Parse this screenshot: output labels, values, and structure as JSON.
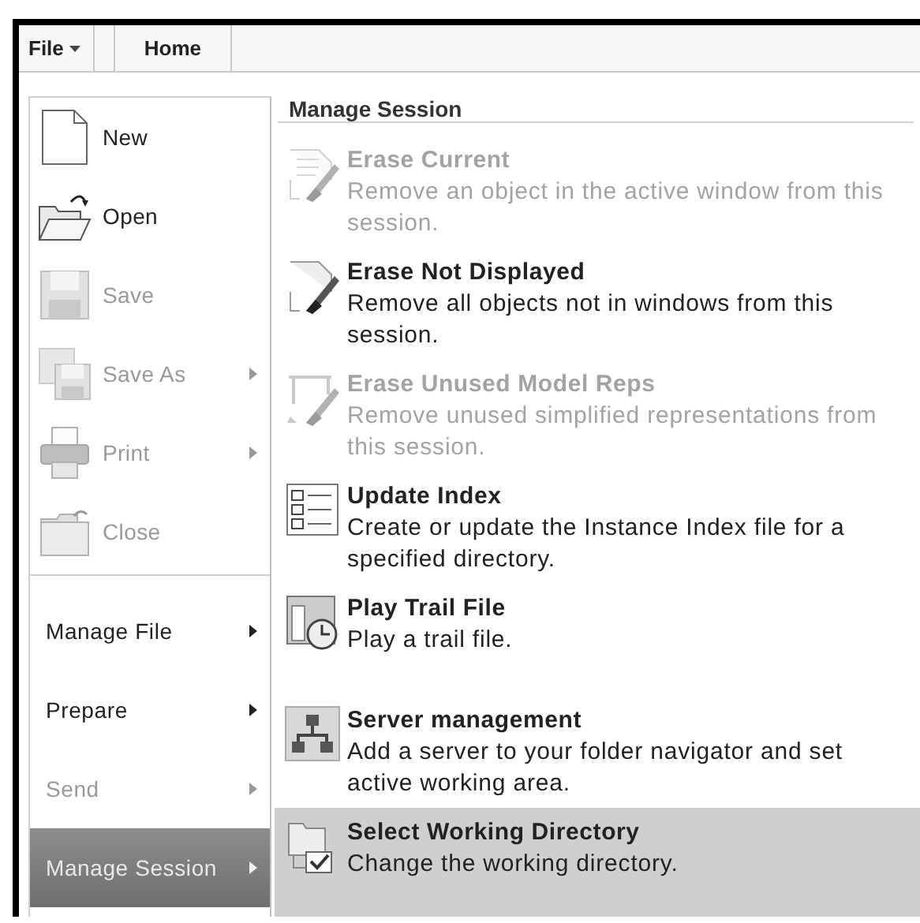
{
  "tabs": [
    {
      "label": "File",
      "kind": "dropdown"
    },
    {
      "label": "Home",
      "kind": "tab"
    }
  ],
  "commands": [
    {
      "label": "New",
      "disabled": false,
      "submenu": false
    },
    {
      "label": "Open",
      "disabled": false,
      "submenu": false
    },
    {
      "label": "Save",
      "disabled": true,
      "submenu": false
    },
    {
      "label": "Save As",
      "disabled": true,
      "submenu": true
    },
    {
      "label": "Print",
      "disabled": true,
      "submenu": true
    },
    {
      "label": "Close",
      "disabled": true,
      "submenu": false
    }
  ],
  "sections": [
    {
      "label": "Manage File",
      "disabled": false,
      "submenu": true,
      "selected": false
    },
    {
      "label": "Prepare",
      "disabled": false,
      "submenu": true,
      "selected": false
    },
    {
      "label": "Send",
      "disabled": true,
      "submenu": true,
      "selected": false
    },
    {
      "label": "Manage Session",
      "disabled": false,
      "submenu": true,
      "selected": true
    }
  ],
  "panel": {
    "title": "Manage Session",
    "items": [
      {
        "title": "Erase Current",
        "description": "Remove an object in the active window from this session.",
        "disabled": true,
        "selected": false
      },
      {
        "title": "Erase Not Displayed",
        "description": "Remove all objects not in windows from this session.",
        "disabled": false,
        "selected": false
      },
      {
        "title": "Erase Unused Model Reps",
        "description": "Remove unused simplified representations from this session.",
        "disabled": true,
        "selected": false
      },
      {
        "title": "Update Index",
        "description": "Create or update the Instance Index file for a specified directory.",
        "disabled": false,
        "selected": false
      },
      {
        "title": "Play Trail File",
        "description": "Play a trail file.",
        "disabled": false,
        "selected": false
      },
      {
        "title": "Server management",
        "description": "Add a server to your folder navigator and set active working area.",
        "disabled": false,
        "selected": false
      },
      {
        "title": "Select Working Directory",
        "description": "Change the working directory.",
        "disabled": false,
        "selected": true
      }
    ]
  }
}
